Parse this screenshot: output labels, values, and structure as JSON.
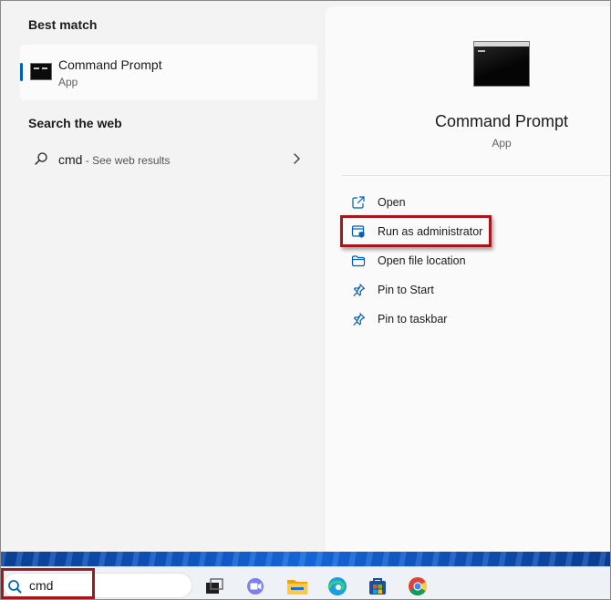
{
  "best_match": {
    "heading": "Best match",
    "item_name": "Command Prompt",
    "item_type": "App"
  },
  "web": {
    "heading": "Search the web",
    "query": "cmd",
    "hint": " - See web results"
  },
  "preview": {
    "title": "Command Prompt",
    "type": "App",
    "actions": [
      {
        "label": "Open",
        "icon": "open-external-icon"
      },
      {
        "label": "Run as administrator",
        "icon": "shield-admin-icon"
      },
      {
        "label": "Open file location",
        "icon": "folder-icon"
      },
      {
        "label": "Pin to Start",
        "icon": "pin-icon"
      },
      {
        "label": "Pin to taskbar",
        "icon": "pin-icon"
      }
    ]
  },
  "taskbar": {
    "search_value": "cmd",
    "apps": [
      "task-view-icon",
      "teams-chat-icon",
      "file-explorer-icon",
      "edge-icon",
      "microsoft-store-icon",
      "chrome-icon"
    ]
  },
  "colors": {
    "accent": "#005fb8",
    "annotation_red": "#a4171b"
  }
}
